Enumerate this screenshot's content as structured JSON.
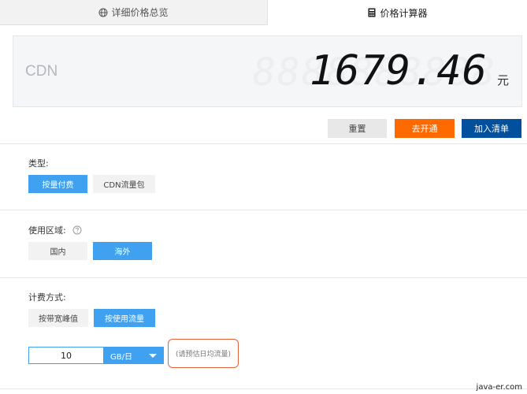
{
  "tabs": {
    "detail": {
      "label": "详细价格总览",
      "icon": "globe-icon"
    },
    "calculator": {
      "label": "价格计算器",
      "icon": "calculator-icon"
    }
  },
  "display": {
    "product": "CDN",
    "ghost_digits": "8888888888",
    "price": "1679.46",
    "unit": "元"
  },
  "actions": {
    "reset": "重置",
    "activate": "去开通",
    "add_to_list": "加入清单"
  },
  "sections": {
    "type": {
      "label": "类型:",
      "options": [
        "按量付费",
        "CDN流量包"
      ],
      "selected": "按量付费"
    },
    "region": {
      "label": "使用区域:",
      "help_icon": "question-circle-icon",
      "options": [
        "国内",
        "海外"
      ],
      "selected": "海外"
    },
    "billing": {
      "label": "计费方式:",
      "options": [
        "按带宽峰值",
        "按使用流量"
      ],
      "selected": "按使用流量"
    }
  },
  "traffic": {
    "value": "10",
    "unit": "GB/日",
    "hint": "(请预估日均流量)"
  },
  "watermark": "java-er.com",
  "colors": {
    "accent_blue": "#3fa1ef",
    "orange": "#ff6a00",
    "navy": "#00509d",
    "hint_border": "#e8633c"
  }
}
